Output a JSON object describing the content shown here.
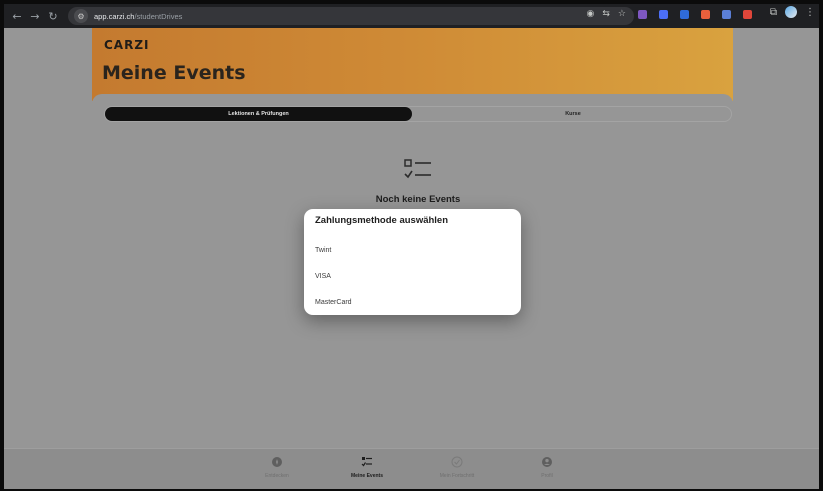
{
  "browser": {
    "url_host": "app.carzi.ch",
    "url_path": "/studentDrives",
    "nav": {
      "back": "←",
      "forward": "→",
      "reload": "↻"
    }
  },
  "app": {
    "logo": "CARZI",
    "page_title": "Meine Events",
    "tabs": [
      "Lektionen & Prüfungen",
      "Kurse"
    ],
    "empty_state": "Noch keine Events",
    "bottom_nav": [
      "Entdecken",
      "Meine Events",
      "Mein Fortschritt",
      "Profil"
    ]
  },
  "dialog": {
    "title": "Zahlungsmethode auswählen",
    "options": [
      "Twint",
      "VISA",
      "MasterCard"
    ]
  },
  "colors": {
    "header_gradient_start": "#c47a2f",
    "header_gradient_end": "#d9a23f",
    "overlay": "#969696",
    "active_tab": "#111111"
  }
}
